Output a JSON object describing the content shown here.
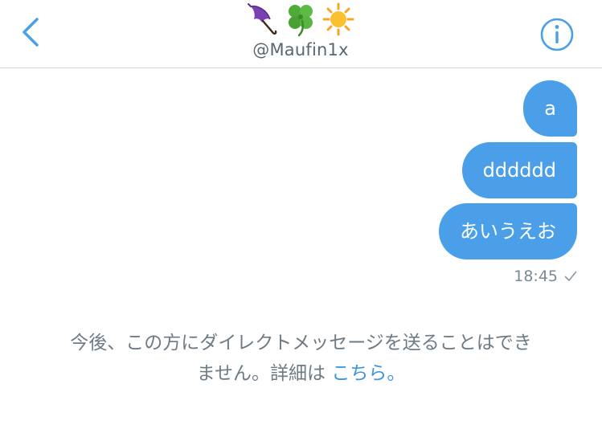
{
  "header": {
    "title_emojis": [
      "umbrella-icon",
      "four-leaf-clover-icon",
      "sun-icon"
    ],
    "handle": "@Maufin1x",
    "back_icon": "chevron-left-icon",
    "info_icon": "info-icon"
  },
  "messages": [
    {
      "text": "a"
    },
    {
      "text": "dddddd"
    },
    {
      "text": "あいうえお"
    }
  ],
  "status": {
    "time": "18:45",
    "read_icon": "checkmark-icon"
  },
  "notice": {
    "line1": "今後、この方にダイレクトメッセージを送ることはでき",
    "line2_prefix": "ません。詳細は ",
    "line2_link": "こちら。"
  },
  "colors": {
    "accent": "#4a9fe8",
    "link": "#3a94df",
    "muted_text": "#6e7b85"
  }
}
